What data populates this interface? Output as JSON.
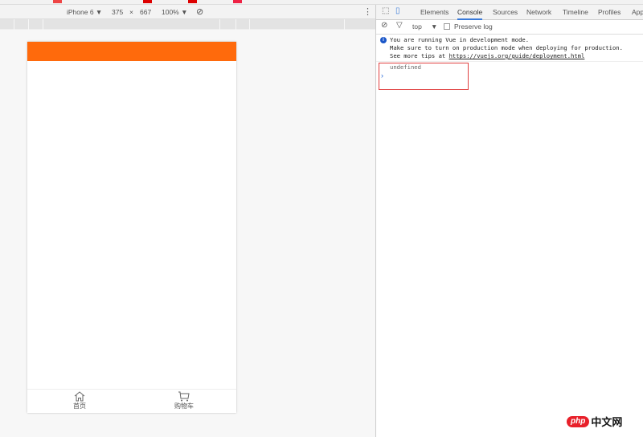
{
  "device_toolbar": {
    "device": "iPhone 6",
    "width": "375",
    "times": "×",
    "height": "667",
    "zoom": "100%"
  },
  "app": {
    "nav": [
      {
        "label": "首页",
        "icon": "home-icon"
      },
      {
        "label": "购物车",
        "icon": "cart-icon"
      }
    ],
    "header_color": "#ff6a0c"
  },
  "devtools": {
    "tabs": [
      "Elements",
      "Console",
      "Sources",
      "Network",
      "Timeline",
      "Profiles",
      "Appl"
    ],
    "active_tab": "Console",
    "context": "top",
    "preserve_log": "Preserve log",
    "messages": {
      "line1": "You are running Vue in development mode.",
      "line2": "Make sure to turn on production mode when deploying for production.",
      "line3_prefix": "See more tips at ",
      "line3_link": "https://vuejs.org/guide/deployment.html"
    },
    "result": "undefined",
    "prompt": "›"
  },
  "watermark": {
    "logo": "php",
    "text": "中文网"
  }
}
